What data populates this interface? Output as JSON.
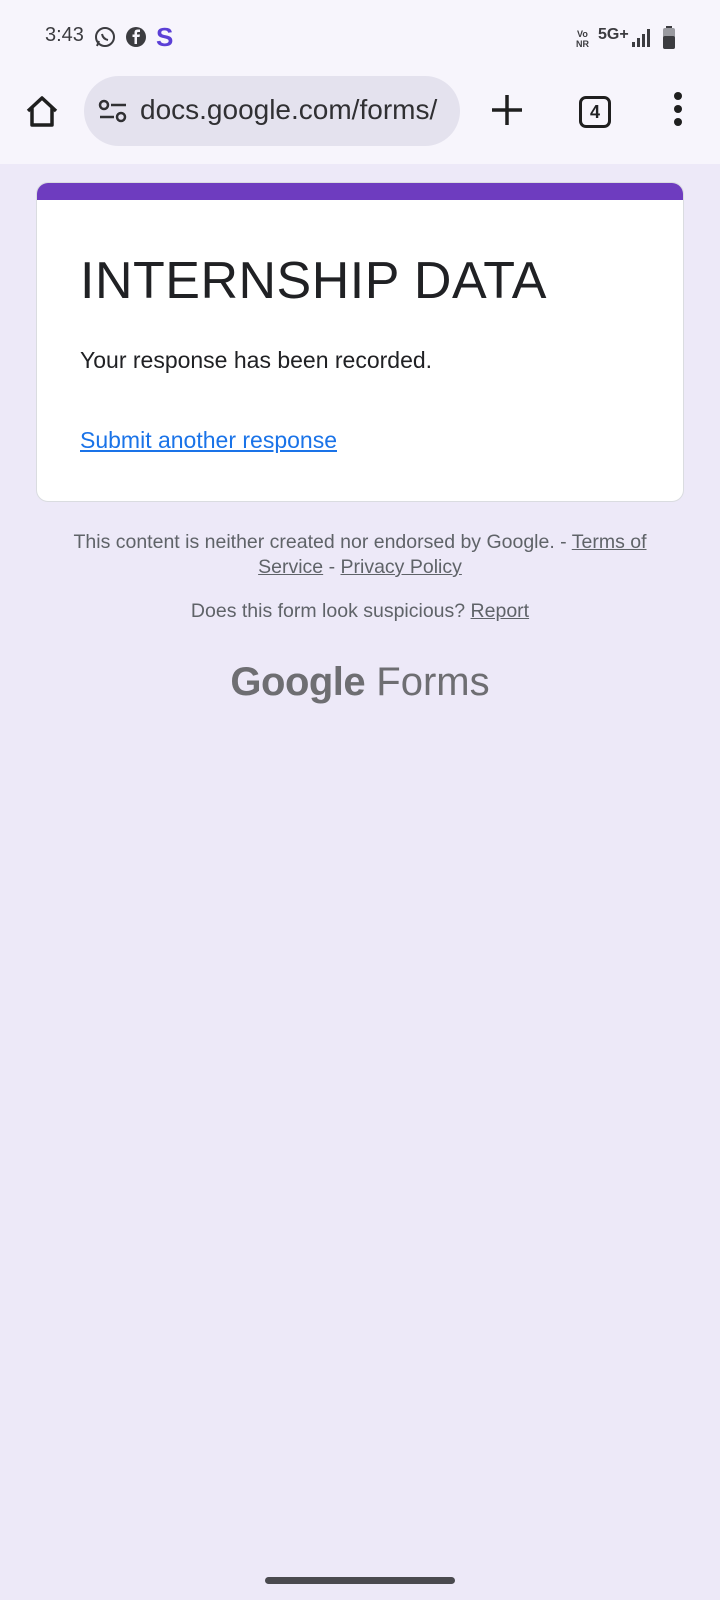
{
  "status_bar": {
    "time": "3:43",
    "network_label": "5G+",
    "volte_label": "Vo NR",
    "icons": [
      "whatsapp-icon",
      "facebook-icon",
      "s-app-icon",
      "signal-icon",
      "battery-icon"
    ]
  },
  "browser": {
    "url": "docs.google.com/forms/",
    "tab_count": "4"
  },
  "form": {
    "title": "INTERNSHIP DATA",
    "message": "Your response has been recorded.",
    "submit_another_label": "Submit another response",
    "accent_color": "#6e3cbf",
    "link_color": "#1a73e8"
  },
  "footer": {
    "disclaimer_text": "This content is neither created nor endorsed by Google. - ",
    "terms_label": "Terms of Service",
    "separator": " - ",
    "privacy_label": "Privacy Policy",
    "suspicious_text": "Does this form look suspicious? ",
    "report_label": "Report",
    "brand_google": "Google",
    "brand_forms": " Forms"
  }
}
